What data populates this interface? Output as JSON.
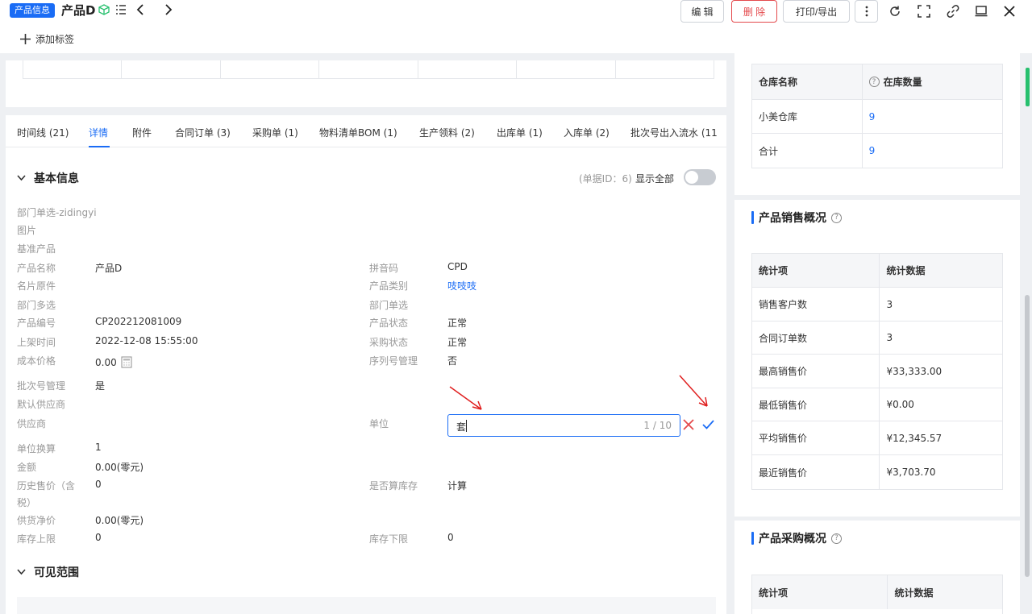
{
  "header": {
    "badge": "产品信息",
    "title": "产品D",
    "add_tag": "添加标签",
    "buttons": {
      "edit": "编 辑",
      "delete": "删 除",
      "print": "打印/导出"
    }
  },
  "tabs": [
    {
      "label": "时间线 (21)"
    },
    {
      "label": "详情"
    },
    {
      "label": "附件"
    },
    {
      "label": "合同订单 (3)"
    },
    {
      "label": "采购单 (1)"
    },
    {
      "label": "物料清单BOM (1)"
    },
    {
      "label": "生产领料 (2)"
    },
    {
      "label": "出库单 (1)"
    },
    {
      "label": "入库单 (2)"
    },
    {
      "label": "批次号出入流水 (11"
    }
  ],
  "basic_info": {
    "title": "基本信息",
    "doc_id": "(单据ID：6)",
    "show_all": "显示全部",
    "left_fields": [
      {
        "label": "部门单选-zidingyi",
        "value": ""
      },
      {
        "label": "图片",
        "value": ""
      },
      {
        "label": "基准产品",
        "value": ""
      },
      {
        "label": "产品名称",
        "value": "产品D"
      },
      {
        "label": "名片原件",
        "value": ""
      },
      {
        "label": "部门多选",
        "value": ""
      },
      {
        "label": "产品编号",
        "value": "CP202212081009"
      },
      {
        "label": "上架时间",
        "value": "2022-12-08 15:55:00"
      },
      {
        "label": "成本价格",
        "value": "0.00"
      },
      {
        "label": "批次号管理",
        "value": "是"
      },
      {
        "label": "默认供应商",
        "value": ""
      },
      {
        "label": "供应商",
        "value": ""
      },
      {
        "label": "单位换算",
        "value": "1"
      },
      {
        "label": "金额",
        "value": "0.00(零元)"
      },
      {
        "label": "历史售价（含",
        "label2": "税）",
        "value": "0"
      },
      {
        "label": "供货净价",
        "value": "0.00(零元)"
      },
      {
        "label": "库存上限",
        "value": "0"
      }
    ],
    "right_fields": [
      {
        "label": "拼音码",
        "value": "CPD"
      },
      {
        "label": "产品类别",
        "value": "吱吱吱"
      },
      {
        "label": "部门单选",
        "value": ""
      },
      {
        "label": "产品状态",
        "value": "正常"
      },
      {
        "label": "采购状态",
        "value": "正常"
      },
      {
        "label": "序列号管理",
        "value": "否"
      },
      {
        "label": "单位",
        "value": ""
      },
      {
        "label": "是否算库存",
        "value": "计算"
      },
      {
        "label": "库存下限",
        "value": "0"
      }
    ],
    "unit_input": {
      "value": "套",
      "count": "1 / 10"
    }
  },
  "visible_range": {
    "title": "可见范围"
  },
  "stock_table": {
    "headers": [
      "仓库名称",
      "在库数量"
    ],
    "rows": [
      [
        "小美仓库",
        "9"
      ],
      [
        "合计",
        "9"
      ]
    ]
  },
  "sales_overview": {
    "title": "产品销售概况",
    "headers": [
      "统计项",
      "统计数据"
    ],
    "rows": [
      [
        "销售客户数",
        "3"
      ],
      [
        "合同订单数",
        "3"
      ],
      [
        "最高销售价",
        "¥33,333.00"
      ],
      [
        "最低销售价",
        "¥0.00"
      ],
      [
        "平均销售价",
        "¥12,345.57"
      ],
      [
        "最近销售价",
        "¥3,703.70"
      ]
    ]
  },
  "purchase_overview": {
    "title": "产品采购概况",
    "headers": [
      "统计项",
      "统计数据"
    ]
  },
  "colors": {
    "accent": "#1a6cf5",
    "danger": "#e4494c",
    "annotation": "#e02020"
  }
}
